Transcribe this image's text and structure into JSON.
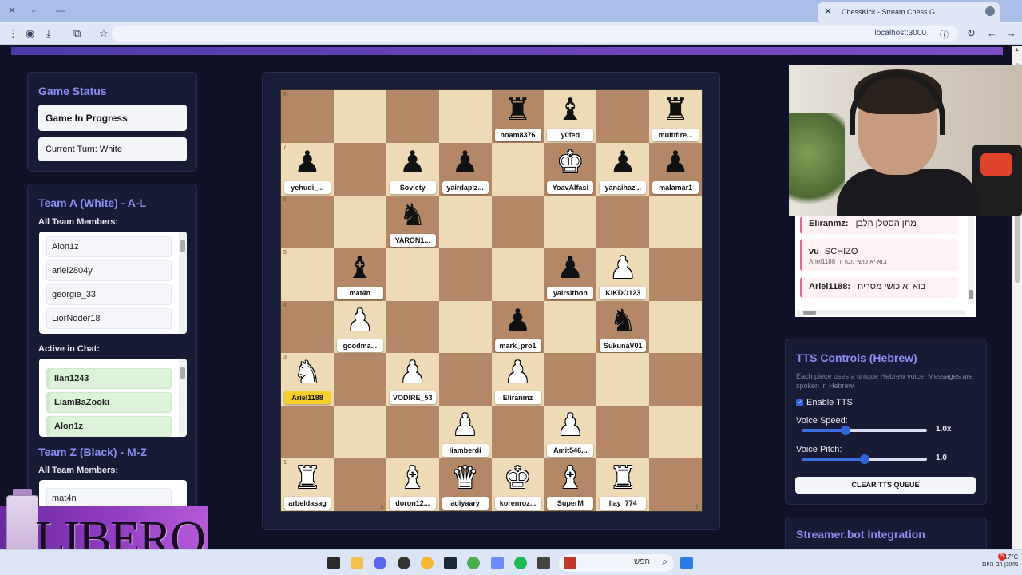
{
  "browser": {
    "tab_title": "ChessKick - Stream Chess G",
    "url": "localhost:3000"
  },
  "game_status": {
    "title": "Game Status",
    "status": "Game In Progress",
    "turn": "Current Turn: White"
  },
  "team_a": {
    "title": "Team A (White) - A-L",
    "members_label": "All Team Members:",
    "members": [
      "Alon1z",
      "ariel2804y",
      "georgie_33",
      "LiorNoder18"
    ],
    "active_label": "Active in Chat:",
    "active": [
      "Ilan1243",
      "LiamBaZooki",
      "Alon1z"
    ]
  },
  "team_z": {
    "title": "Team Z (Black) - M-Z",
    "members_label": "All Team Members:",
    "members": [
      "mat4n"
    ]
  },
  "board": {
    "coords": {
      "r8": "8",
      "r7": "7",
      "r6": "6",
      "r5": "5",
      "r4": "4",
      "r3": "3",
      "r1": "1",
      "fb": "b",
      "fh": "h"
    },
    "pieces": {
      "e8": {
        "glyph": "♜",
        "color": "b",
        "player": "noam8376"
      },
      "f8": {
        "glyph": "♝",
        "color": "b",
        "player": "y0fed"
      },
      "h8": {
        "glyph": "♜",
        "color": "b",
        "player": "multifire..."
      },
      "a7": {
        "glyph": "♟",
        "color": "b",
        "player": "yehudi_..."
      },
      "c7": {
        "glyph": "♟",
        "color": "b",
        "player": "Soviety"
      },
      "d7": {
        "glyph": "♟",
        "color": "b",
        "player": "yairdapiz..."
      },
      "f7": {
        "glyph": "♚",
        "color": "w",
        "player": "YoavAlfasi"
      },
      "g7": {
        "glyph": "♟",
        "color": "b",
        "player": "yanaihaz..."
      },
      "h7": {
        "glyph": "♟",
        "color": "b",
        "player": "malamar1"
      },
      "c6": {
        "glyph": "♞",
        "color": "b",
        "player": "YARON1..."
      },
      "b5": {
        "glyph": "♝",
        "color": "b",
        "player": "mat4n"
      },
      "f5": {
        "glyph": "♟",
        "color": "b",
        "player": "yairsitbon"
      },
      "g5": {
        "glyph": "♟",
        "color": "w",
        "player": "KIKDO123"
      },
      "b4": {
        "glyph": "♟",
        "color": "w",
        "player": "goodma..."
      },
      "e4": {
        "glyph": "♟",
        "color": "b",
        "player": "mark_pro1"
      },
      "g4": {
        "glyph": "♞",
        "color": "b",
        "player": "SukunaV01"
      },
      "a3": {
        "glyph": "♞",
        "color": "w",
        "player": "Ariel1188",
        "highlight": true,
        "bubble": "בוא יא כושי מסריח"
      },
      "c3": {
        "glyph": "♟",
        "color": "w",
        "player": "VODIRE_53"
      },
      "e3": {
        "glyph": "♟",
        "color": "w",
        "player": "Eliranmz"
      },
      "d2": {
        "glyph": "♟",
        "color": "w",
        "player": "liamberdi"
      },
      "f2": {
        "glyph": "♟",
        "color": "w",
        "player": "Amit546..."
      },
      "a1": {
        "glyph": "♜",
        "color": "w",
        "player": "arbeldasag"
      },
      "c1": {
        "glyph": "♝",
        "color": "w",
        "player": "doron12..."
      },
      "d1": {
        "glyph": "♛",
        "color": "w",
        "player": "adiyaary"
      },
      "e1": {
        "glyph": "♚",
        "color": "w",
        "player": "korenroz..."
      },
      "f1": {
        "glyph": "♝",
        "color": "w",
        "player": "SuperM"
      },
      "g1": {
        "glyph": "♜",
        "color": "w",
        "player": "Ilay_774"
      }
    }
  },
  "chat": {
    "messages": [
      {
        "user": "Eliranmz:",
        "text": "מתן הסטלן הלבן"
      },
      {
        "user": "vu",
        "text": "SCHIZO",
        "garble": "Ariel1188 בוא יא כושי מסריח"
      },
      {
        "user": "Ariel1188:",
        "text": "בוא יא כושי מסריח"
      }
    ]
  },
  "tts": {
    "title": "TTS Controls (Hebrew)",
    "desc": "Each piece uses a unique Hebrew voice. Messages are spoken in Hebrew.",
    "enable_label": "Enable TTS",
    "speed_label": "Voice Speed:",
    "speed_value": "1.0x",
    "speed_fraction": 0.35,
    "pitch_label": "Voice Pitch:",
    "pitch_value": "1.0",
    "pitch_fraction": 0.5,
    "clear_label": "CLEAR TTS QUEUE"
  },
  "streamerbot": {
    "title": "Streamer.bot Integration"
  },
  "overlay": {
    "brand": "LIBERO"
  },
  "taskbar": {
    "search_placeholder": "חפש",
    "temp": "17°C",
    "weather": "מעונן רב היום",
    "badge": "5"
  }
}
